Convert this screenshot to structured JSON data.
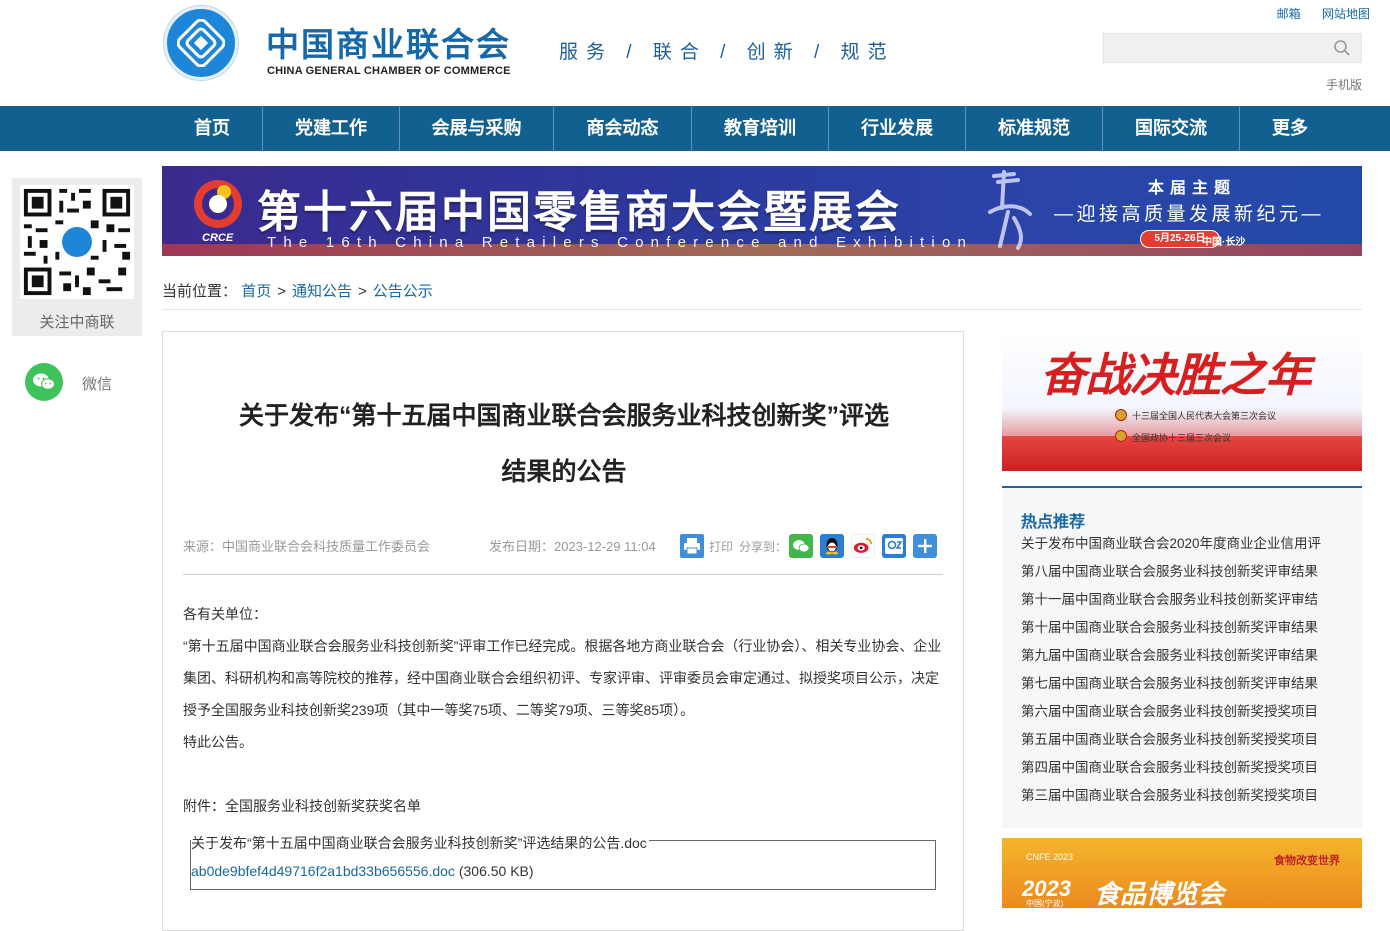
{
  "header": {
    "org_name_cn": "中国商业联合会",
    "org_name_en": "CHINA GENERAL CHAMBER OF COMMERCE",
    "slogan": "服务 / 联合 / 创新 / 规范",
    "top_links": [
      "邮箱",
      "网站地图"
    ],
    "search_placeholder": "",
    "mobile_link": "手机版"
  },
  "nav": {
    "items": [
      "首页",
      "党建工作",
      "会展与采购",
      "商会动态",
      "教育培训",
      "行业发展",
      "标准规范",
      "国际交流",
      "更多"
    ]
  },
  "side_float": {
    "qr_label": "关注中商联",
    "wechat_label": "微信"
  },
  "banner": {
    "logo_text": "CRCE",
    "title": "第十六届中国零售商大会暨展会",
    "subtitle_en": "The 16th China Retailers Conference and Exhibition",
    "theme_title": "本届主题",
    "theme": "—迎接高质量发展新纪元—",
    "date": "5月25-26日",
    "place": "中国·长沙"
  },
  "breadcrumb": {
    "prefix": "当前位置：",
    "items": [
      "首页",
      "通知公告",
      "公告公示"
    ],
    "separator": ">"
  },
  "article": {
    "title": "关于发布“第十五届中国商业联合会服务业科技创新奖”评选结果的公告",
    "source": "来源：中国商业联合会科技质量工作委员会",
    "date": "发布日期：2023-12-29 11:04",
    "print_label": "打印",
    "share_label": "分享到：",
    "salutation": "各有关单位：",
    "paragraph": "“第十五届中国商业联合会服务业科技创新奖”评审工作已经完成。根据各地方商业联合会（行业协会）、相关专业协会、企业集团、科研机构和高等院校的推荐，经中国商业联合会组织初评、专家评审、评审委员会审定通过、拟授奖项目公示，决定授予全国服务业科技创新奖239项（其中一等奖75项、二等奖79项、三等奖85项）。",
    "closing": "特此公告。",
    "attachment_label": "附件：全国服务业科技创新奖获奖名单",
    "file_name": "关于发布“第十五届中国商业联合会服务业科技创新奖”评选结果的公告.doc",
    "file_link": "ab0de9bfef4d49716f2a1bd33b656556.doc",
    "file_size": "(306.50 KB)"
  },
  "right_banner": {
    "title": "奋战决胜之年",
    "line1": "十三届全国人民代表大会第三次会议",
    "line2": "全国政协十三届三次会议"
  },
  "hot": {
    "title": "热点推荐",
    "items": [
      "关于发布中国商业联合会2020年度商业企业信用评",
      "第八届中国商业联合会服务业科技创新奖评审结果",
      "第十一届中国商业联合会服务业科技创新奖评审结",
      "第十届中国商业联合会服务业科技创新奖评审结果",
      "第九届中国商业联合会服务业科技创新奖评审结果",
      "第七届中国商业联合会服务业科技创新奖评审结果",
      "第六届中国商业联合会服务业科技创新奖授奖项目",
      "第五届中国商业联合会服务业科技创新奖授奖项目",
      "第四届中国商业联合会服务业科技创新奖授奖项目",
      "第三届中国商业联合会服务业科技创新奖授奖项目"
    ]
  },
  "food_banner": {
    "tag": "CNFE 2023",
    "year": "2023",
    "title": "食品博览会",
    "slogan": "食物改变世界",
    "place": "中国(宁波)"
  },
  "colors": {
    "nav_bg": "#12608f",
    "brand_blue": "#1668a8",
    "wechat_green": "#3dc35a"
  }
}
